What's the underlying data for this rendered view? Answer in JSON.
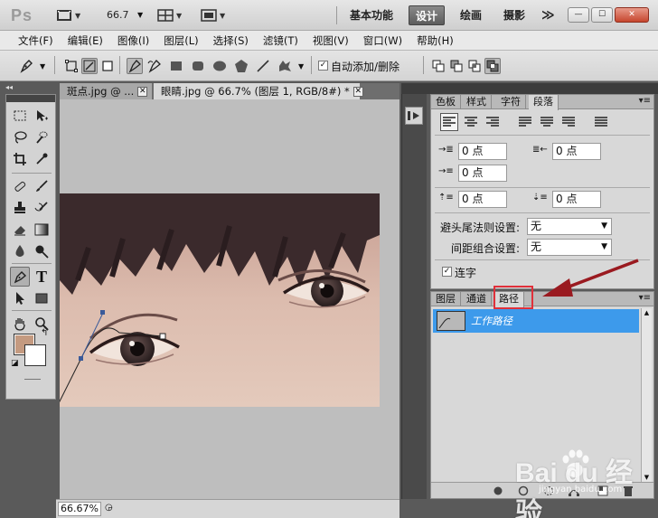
{
  "app": {
    "logo": "Ps",
    "zoom": "66.7"
  },
  "workspaces": [
    {
      "label": "基本功能",
      "active": false
    },
    {
      "label": "设计",
      "active": true
    },
    {
      "label": "绘画",
      "active": false
    },
    {
      "label": "摄影",
      "active": false
    },
    {
      "label": "≫",
      "active": false
    }
  ],
  "window_controls": {
    "minimize": "—",
    "maximize": "☐",
    "close": "✕"
  },
  "menu": [
    "文件(F)",
    "编辑(E)",
    "图像(I)",
    "图层(L)",
    "选择(S)",
    "滤镜(T)",
    "视图(V)",
    "窗口(W)",
    "帮助(H)"
  ],
  "options": {
    "auto_add_delete_checked": true,
    "auto_add_delete_label": "自动添加/删除",
    "check_glyph": "✓"
  },
  "tabs": [
    {
      "label": "斑点.jpg @ ...",
      "active": false
    },
    {
      "label": "眼睛.jpg @ 66.7% (图层 1, RGB/8#) *",
      "active": true
    }
  ],
  "tab_close": "✕",
  "status": {
    "zoom": "66.67%"
  },
  "colors": {
    "foreground": "#c49a80",
    "background": "#ffffff",
    "highlight_red": "#e0303a",
    "selection_blue": "#3d9aeb"
  },
  "panel1": {
    "tabs": [
      {
        "label": "色板",
        "active": false
      },
      {
        "label": "样式",
        "active": false
      },
      {
        "label": "字符",
        "active": false
      },
      {
        "label": "段落",
        "active": true
      }
    ],
    "menu_icon": "▾≡",
    "indent_left": "0 点",
    "indent_right": "0 点",
    "indent_first": "0 点",
    "space_before": "0 点",
    "space_after": "0 点",
    "kinsoku_label": "避头尾法则设置:",
    "kinsoku_value": "无",
    "mojikumi_label": "间距组合设置:",
    "mojikumi_value": "无",
    "hyphenate_label": "连字",
    "hyphenate_checked": true
  },
  "panel2": {
    "tabs": [
      {
        "label": "图层",
        "active": false
      },
      {
        "label": "通道",
        "active": false
      },
      {
        "label": "路径",
        "active": true
      }
    ],
    "menu_icon": "▾≡",
    "paths": [
      {
        "name": "工作路径",
        "selected": true
      }
    ]
  },
  "watermark": {
    "brand": "Bai du 经验",
    "url": "jingyan.baidu.com"
  }
}
